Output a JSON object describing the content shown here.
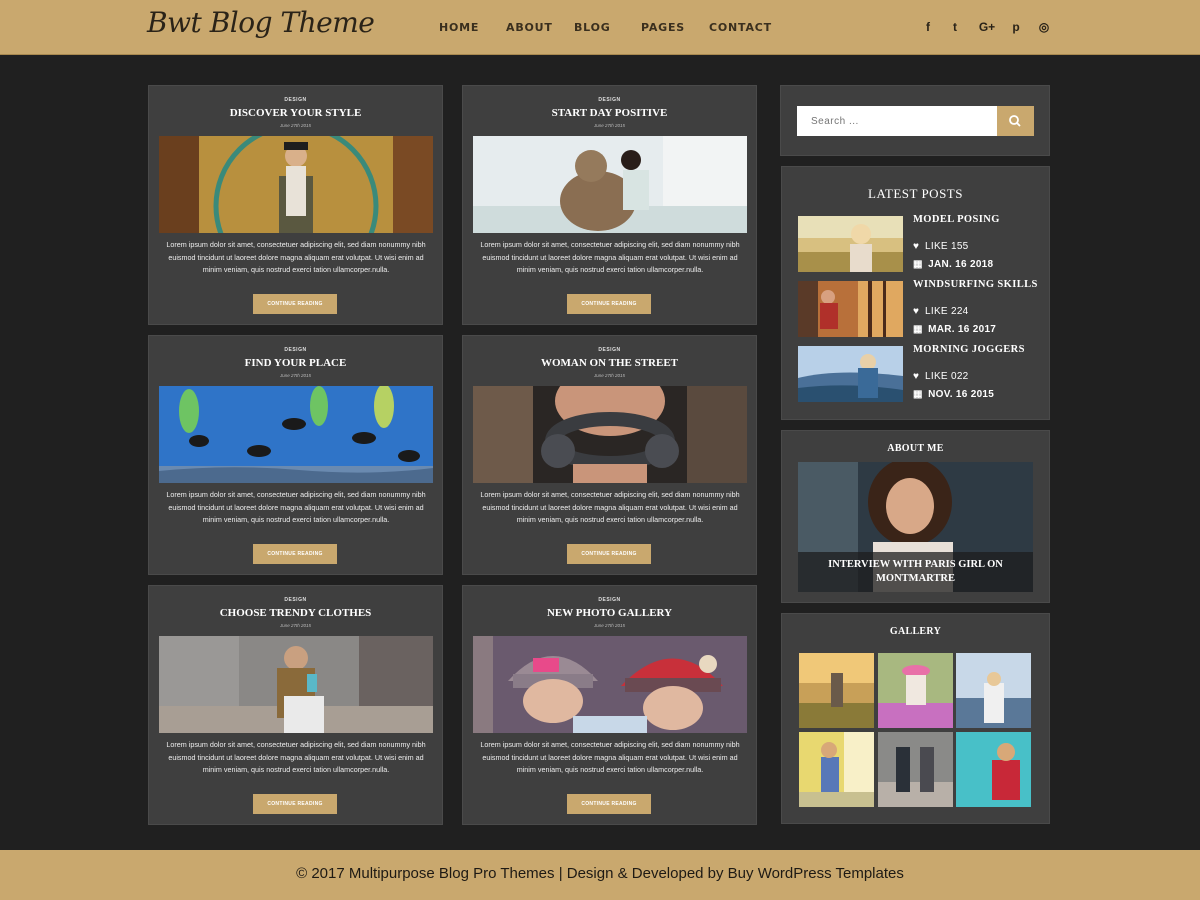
{
  "header": {
    "logo": "Bwt Blog Theme",
    "nav": [
      "HOME",
      "ABOUT",
      "BLOG",
      "PAGES",
      "CONTACT"
    ],
    "social_icons": [
      "facebook-icon",
      "twitter-icon",
      "google-plus-icon",
      "pinterest-icon",
      "instagram-icon"
    ],
    "social_glyphs": [
      "f",
      "t",
      "G+",
      "p",
      "◎"
    ]
  },
  "posts": [
    {
      "category": "DESIGN",
      "title": "DISCOVER YOUR STYLE",
      "date": "June 27th 2015",
      "excerpt": "Lorem ipsum dolor sit amet, consectetuer adipiscing elit, sed diam nonummy nibh euismod tincidunt ut laoreet dolore magna aliquam erat volutpat. Ut wisi enim ad minim veniam, quis nostrud exerci tation ullamcorper.nulla.",
      "button": "CONTINUE READING"
    },
    {
      "category": "DESIGN",
      "title": "START DAY POSITIVE",
      "date": "June 27th 2015",
      "excerpt": "Lorem ipsum dolor sit amet, consectetuer adipiscing elit, sed diam nonummy nibh euismod tincidunt ut laoreet dolore magna aliquam erat volutpat. Ut wisi enim ad minim veniam, quis nostrud exerci tation ullamcorper.nulla.",
      "button": "CONTINUE READING"
    },
    {
      "category": "DESIGN",
      "title": "FIND YOUR PLACE",
      "date": "June 27th 2015",
      "excerpt": "Lorem ipsum dolor sit amet, consectetuer adipiscing elit, sed diam nonummy nibh euismod tincidunt ut laoreet dolore magna aliquam erat volutpat. Ut wisi enim ad minim veniam, quis nostrud exerci tation ullamcorper.nulla.",
      "button": "CONTINUE READING"
    },
    {
      "category": "DESIGN",
      "title": "WOMAN ON THE STREET",
      "date": "June 27th 2015",
      "excerpt": "Lorem ipsum dolor sit amet, consectetuer adipiscing elit, sed diam nonummy nibh euismod tincidunt ut laoreet dolore magna aliquam erat volutpat. Ut wisi enim ad minim veniam, quis nostrud exerci tation ullamcorper.nulla.",
      "button": "CONTINUE READING"
    },
    {
      "category": "DESIGN",
      "title": "CHOOSE TRENDY CLOTHES",
      "date": "June 27th 2015",
      "excerpt": "Lorem ipsum dolor sit amet, consectetuer adipiscing elit, sed diam nonummy nibh euismod tincidunt ut laoreet dolore magna aliquam erat volutpat. Ut wisi enim ad minim veniam, quis nostrud exerci tation ullamcorper.nulla.",
      "button": "CONTINUE READING"
    },
    {
      "category": "DESIGN",
      "title": "NEW PHOTO GALLERY",
      "date": "June 27th 2015",
      "excerpt": "Lorem ipsum dolor sit amet, consectetuer adipiscing elit, sed diam nonummy nibh euismod tincidunt ut laoreet dolore magna aliquam erat volutpat. Ut wisi enim ad minim veniam, quis nostrud exerci tation ullamcorper.nulla.",
      "button": "CONTINUE READING"
    }
  ],
  "search": {
    "placeholder": "Search ..."
  },
  "latest_posts": {
    "title": "LATEST POSTS",
    "items": [
      {
        "title": "MODEL POSING",
        "likes": "LIKE 155",
        "date": "JAN. 16 2018"
      },
      {
        "title": "WINDSURFING SKILLS",
        "likes": "LIKE 224",
        "date": "MAR. 16 2017"
      },
      {
        "title": "MORNING JOGGERS",
        "likes": "LIKE 022",
        "date": "NOV. 16 2015"
      }
    ]
  },
  "about": {
    "title": "ABOUT ME",
    "caption": "INTERVIEW WITH PARIS GIRL ON MONTMARTRE"
  },
  "gallery": {
    "title": "GALLERY"
  },
  "footer": {
    "text": "© 2017 Multipurpose Blog Pro Themes | Design & Developed by Buy WordPress Templates"
  },
  "colors": {
    "accent": "#c9a86e",
    "background": "#202020",
    "card": "#3f3f3f"
  }
}
